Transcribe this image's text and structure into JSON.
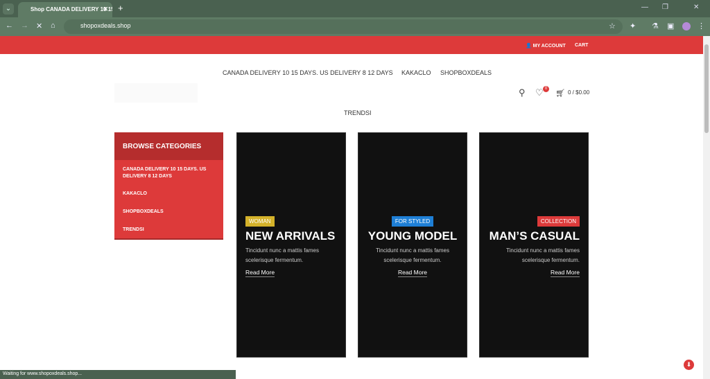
{
  "browser": {
    "tab_title": "Shop CANADA DELIVERY 10 15 DAYS",
    "url": "shopoxdeals.shop",
    "status": "Waiting for www.shopoxdeals.shop..."
  },
  "topbar": {
    "account": "MY ACCOUNT",
    "cart": "CART"
  },
  "nav": {
    "items": [
      "CANADA DELIVERY 10 15 DAYS. US DELIVERY 8 12 DAYS",
      "KAKACLO",
      "SHOPBOXDEALS"
    ],
    "second_row": "TRENDSI"
  },
  "header": {
    "wishlist_count": "0",
    "cart_total": "0 / $0.00"
  },
  "sidebar": {
    "title": "BROWSE CATEGORIES",
    "items": [
      "CANADA DELIVERY 10 15 DAYS. US DELIVERY 8 12 DAYS",
      "KAKACLO",
      "SHOPBOXDEALS",
      "TRENDSI"
    ]
  },
  "banners": [
    {
      "tag": "WOMAN",
      "tag_color": "#d4b22a",
      "title": "NEW ARRIVALS",
      "text": "Tincidunt nunc a mattis fames scelerisque fermentum.",
      "link": "Read More"
    },
    {
      "tag": "FOR STYLED",
      "tag_color": "#1e7fd6",
      "title": "YOUNG MODEL",
      "text": "Tincidunt nunc a mattis fames scelerisque fermentum.",
      "link": "Read More"
    },
    {
      "tag": "COLLECTION",
      "tag_color": "#dd3a3a",
      "title": "MAN’S CASUAL",
      "text": "Tincidunt nunc a mattis fames scelerisque fermentum.",
      "link": "Read More"
    }
  ]
}
